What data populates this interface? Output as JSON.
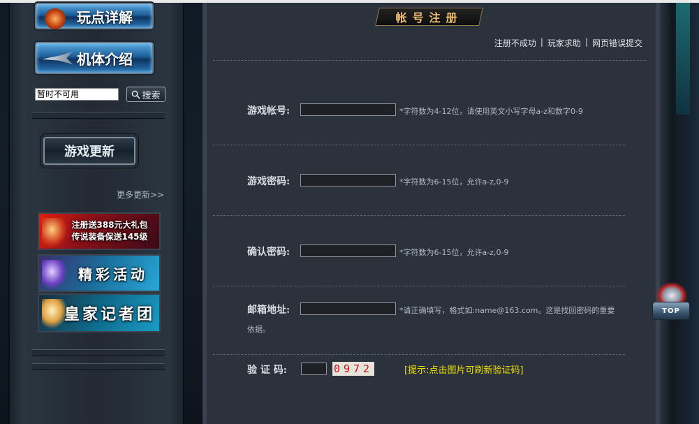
{
  "nav": {
    "btn_playpoints": "玩点详解",
    "btn_mechs": "机体介绍",
    "search_value": "暂时不可用",
    "search_button": "搜索",
    "game_update": "游戏更新",
    "more_updates": "更多更新>>",
    "banners": {
      "b1_line1": "注册送388元大礼包",
      "b1_line2": "传说装备保送145级",
      "b2": "精彩活动",
      "b3": "皇家记者团"
    }
  },
  "page": {
    "title": "帐号注册",
    "links": [
      "注册不成功",
      "玩家求助",
      "网页错误提交"
    ]
  },
  "form": {
    "account_label": "游戏帐号:",
    "account_hint": "*字符数为4-12位，请使用英文小写字母a-z和数字0-9",
    "password_label": "游戏密码:",
    "password_hint": "*字符数为6-15位，允许a-z,0-9",
    "confirm_label": "确认密码:",
    "confirm_hint": "*字符数为6-15位，允许a-z,0-9",
    "email_label": "邮箱地址:",
    "email_hint_1": "*请正确填写，格式如:name@163.com。这是找回密码的重要",
    "email_hint_2": "依据。",
    "captcha_label": "验 证 码:",
    "captcha_code": "0972",
    "captcha_tip": "[提示:点击图片可刷新验证码]"
  },
  "top_button": "TOP"
}
